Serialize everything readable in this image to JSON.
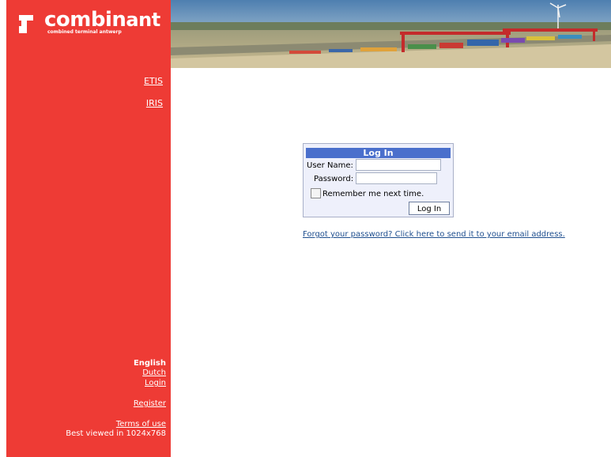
{
  "brand": {
    "logo_word": "combin",
    "logo_suffix": "ant",
    "tagline": "combined terminal antwerp"
  },
  "sidebar": {
    "apps": [
      {
        "label": "ETIS"
      },
      {
        "label": "IRIS"
      }
    ],
    "language_current": "English",
    "language_dutch": "Dutch",
    "login_link": "Login",
    "register_link": "Register",
    "terms_link": "Terms of use",
    "best_viewed": "Best viewed in 1024x768"
  },
  "login": {
    "title": "Log In",
    "username_label": "User Name:",
    "username_value": "",
    "password_label": "Password:",
    "password_value": "",
    "remember_label": "Remember me next time.",
    "remember_checked": false,
    "submit_label": "Log In"
  },
  "forgot_link": "Forgot your password? Click here to send it to your email address.",
  "colors": {
    "sidebar": "#ee3b35",
    "login_header": "#4a6fcc",
    "link": "#1f4f8f"
  }
}
